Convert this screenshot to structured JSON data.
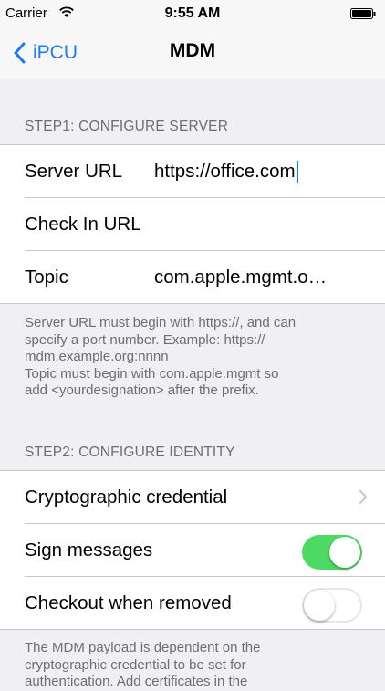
{
  "status_bar": {
    "carrier": "Carrier",
    "time": "9:55 AM"
  },
  "nav": {
    "back_label": "iPCU",
    "title": "MDM"
  },
  "step1": {
    "header": "STEP1: CONFIGURE SERVER",
    "rows": [
      {
        "label": "Server URL",
        "value": "https://office.com"
      },
      {
        "label": "Check In URL",
        "value": ""
      },
      {
        "label": "Topic",
        "value": "com.apple.mgmt.o…"
      }
    ],
    "footer_lines": [
      "Server URL must begin with https://, and can",
      "specify a port number. Example: https://",
      "mdm.example.org:nnnn",
      "Topic must begin with com.apple.mgmt so",
      "add <yourdesignation> after the prefix."
    ]
  },
  "step2": {
    "header": "STEP2: CONFIGURE IDENTITY",
    "rows": [
      {
        "label": "Cryptographic credential"
      },
      {
        "label": "Sign messages",
        "toggle": "on"
      },
      {
        "label": "Checkout when removed",
        "toggle": "off"
      }
    ],
    "footer_lines": [
      "The MDM payload is dependent on the",
      "cryptographic credential to be set for",
      "authentication. Add certificates in the"
    ]
  },
  "colors": {
    "accent": "#1a7cf5",
    "toggle_on": "#4cd964",
    "background": "#efeff4"
  }
}
